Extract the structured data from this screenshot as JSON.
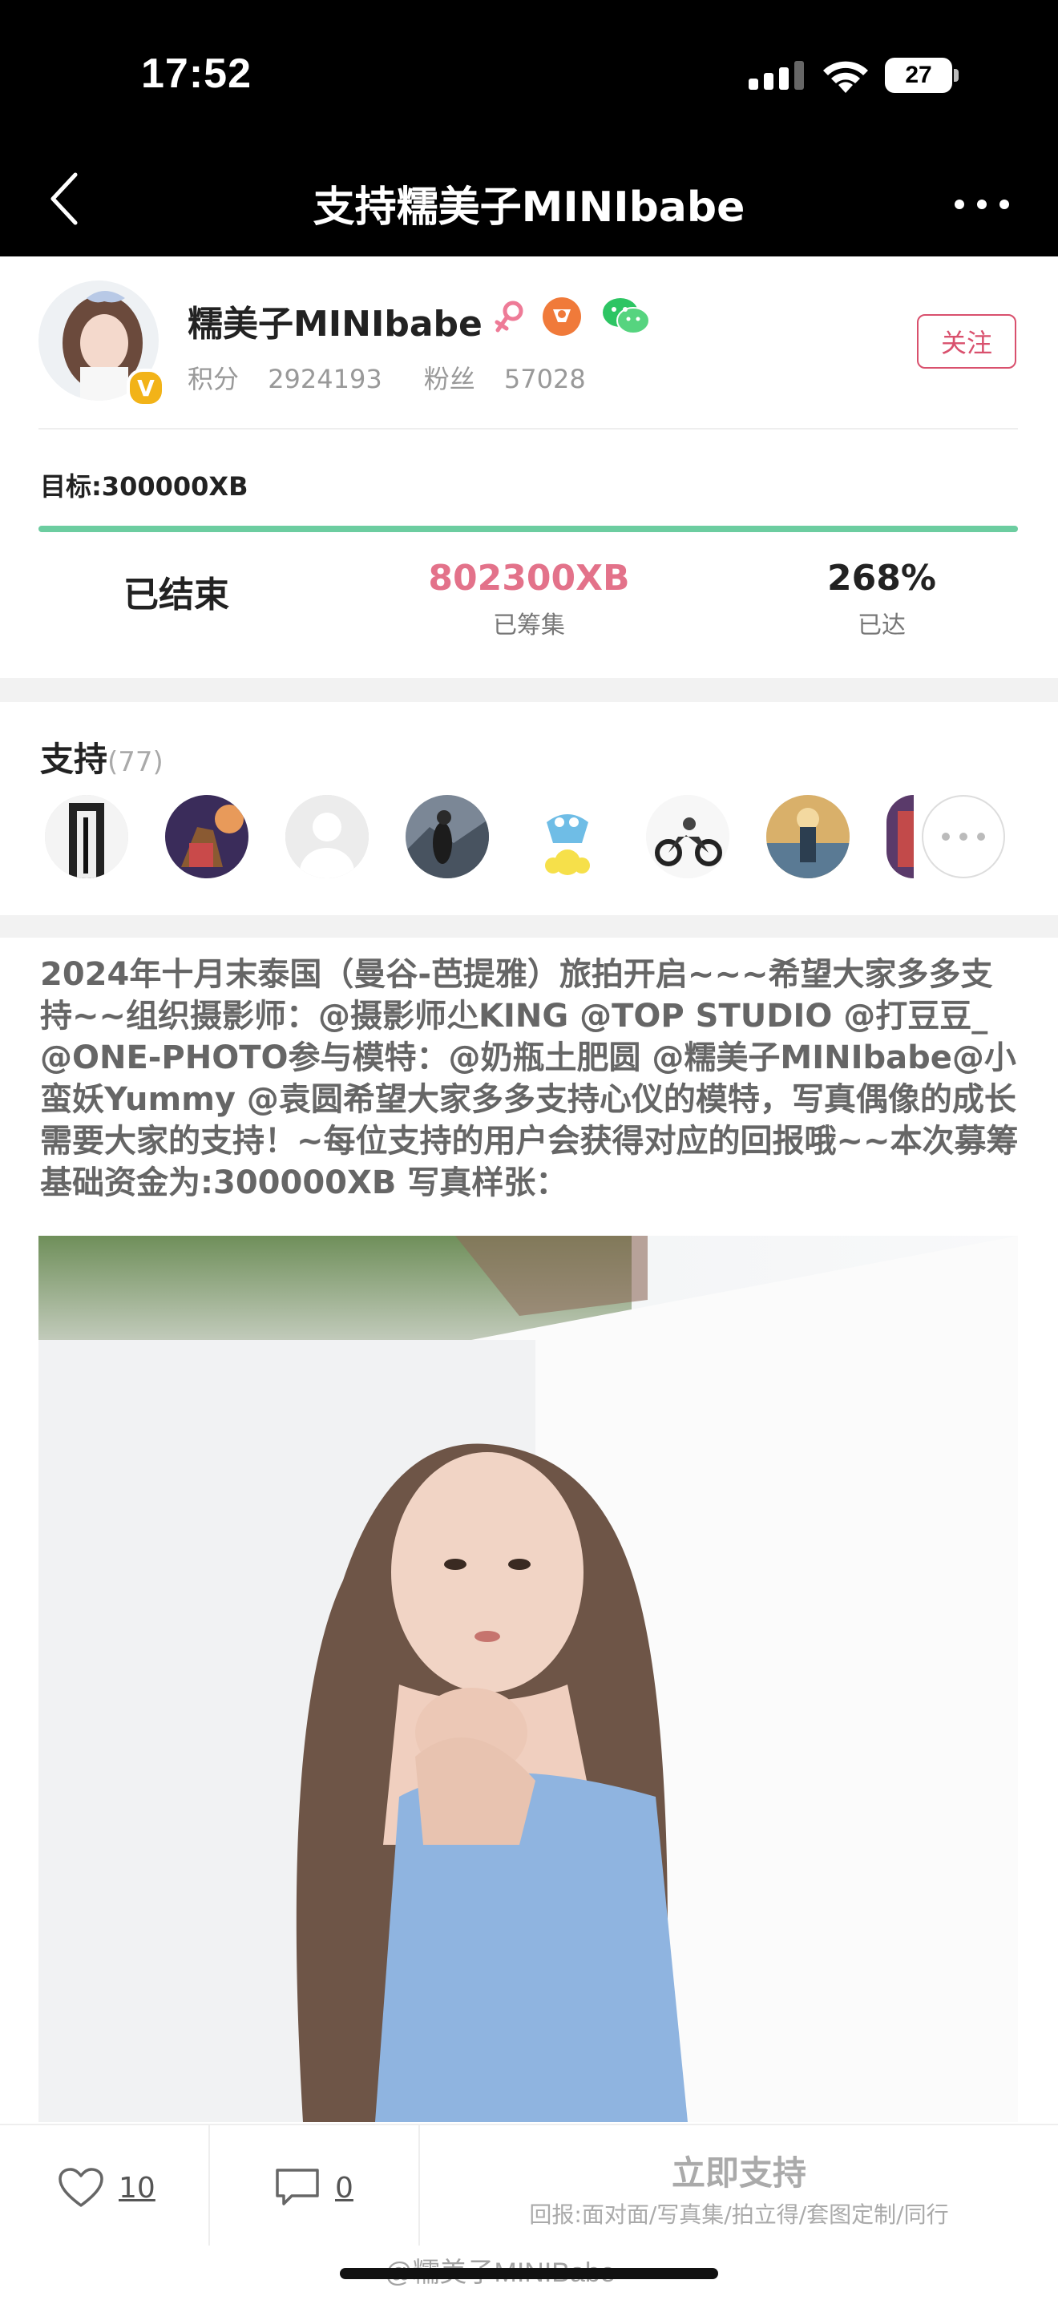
{
  "status_bar": {
    "time": "17:52",
    "battery": "27"
  },
  "nav": {
    "title": "支持糯美子MINIbabe"
  },
  "profile": {
    "name": "糯美子MINIbabe",
    "verified_badge": "V",
    "points_label": "积分",
    "points_value": "2924193",
    "fans_label": "粉丝",
    "fans_value": "57028",
    "follow_label": "关注"
  },
  "campaign": {
    "goal": "目标:300000XB",
    "progress_fraction": 1.0,
    "status": "已结束",
    "raised_value": "802300XB",
    "raised_label": "已筹集",
    "percent_value": "268%",
    "percent_label": "已达"
  },
  "supporters": {
    "title": "支持",
    "count": "(77)"
  },
  "description": "2024年十月末泰国（曼谷-芭提雅）旅拍开启~~~希望大家多多支持~~组织摄影师：@摄影师尐KING @TOP STUDIO @打豆豆_ @ONE-PHOTO参与模特：@奶瓶土肥圆 @糯美子MINIbabe@小蛮妖Yummy @袁圆希望大家多多支持心仪的模特，写真偶像的成长需要大家的支持！~每位支持的用户会获得对应的回报哦~~本次募筹基础资金为:300000XB 写真样张：",
  "actions": {
    "like_count": "10",
    "comment_count": "0",
    "support_label": "立即支持",
    "reward_text": "回报:面对面/写真集/拍立得/套图定制/同行"
  },
  "watermark": "@糯美子MINIBabe",
  "colors": {
    "accent_pink": "#e3728a",
    "progress_green": "#6ccda0",
    "follow_red": "#d9506d"
  }
}
